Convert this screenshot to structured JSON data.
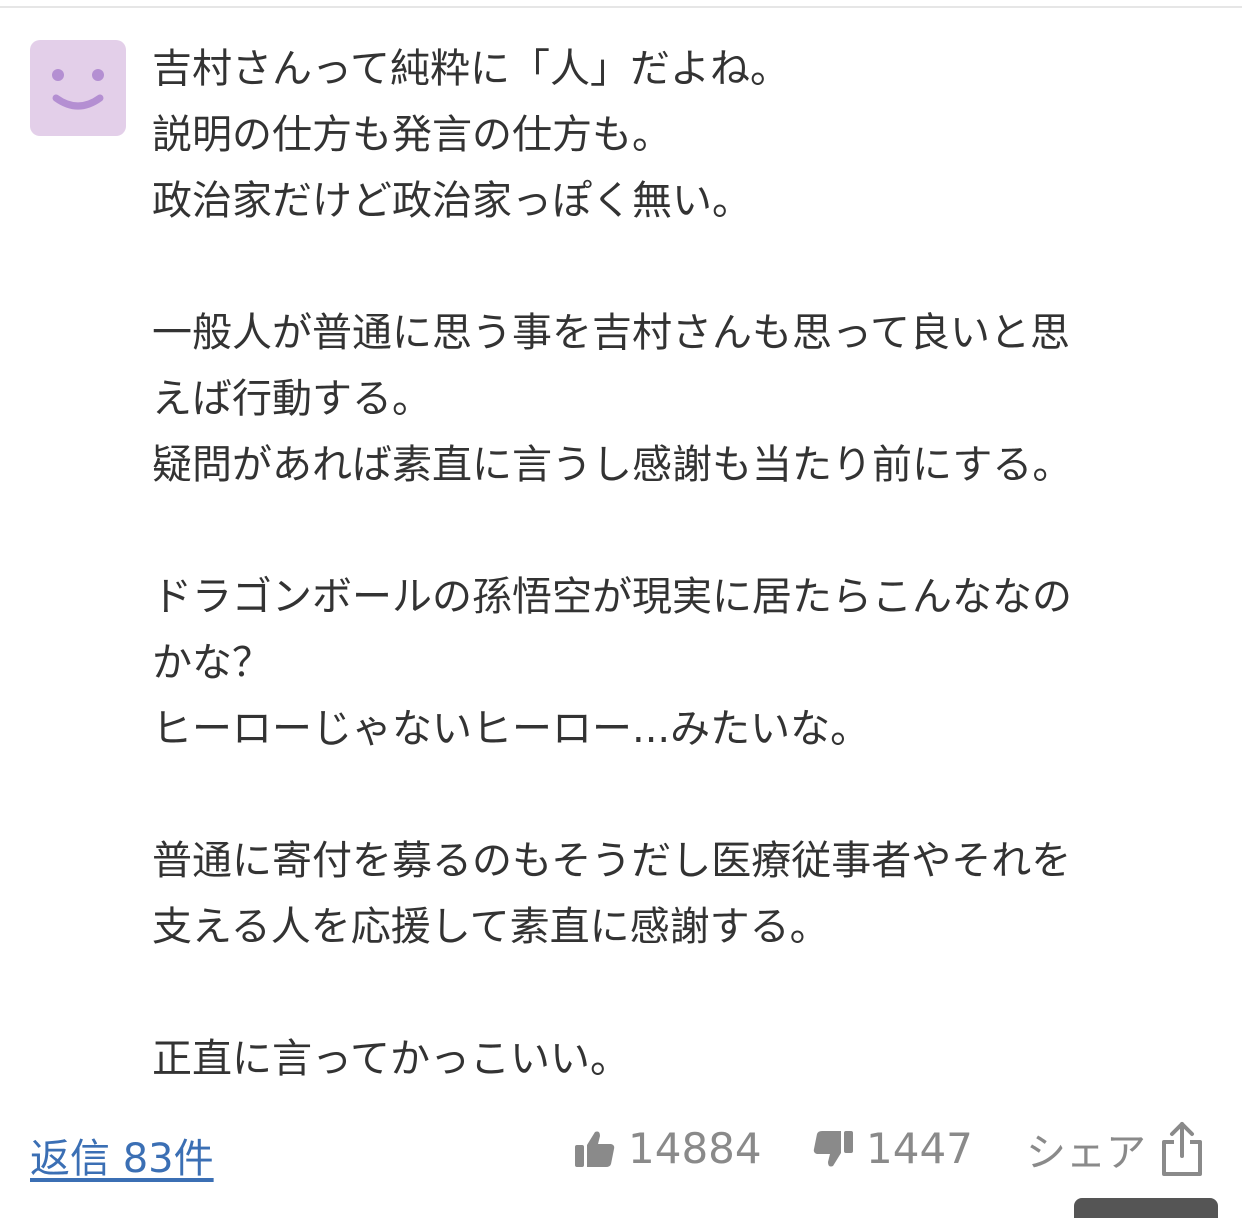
{
  "comment": {
    "lines": [
      "吉村さんって純粋に「人」だよね。",
      "説明の仕方も発言の仕方も。",
      "政治家だけど政治家っぽく無い。",
      "",
      "一般人が普通に思う事を吉村さんも思って良いと思",
      "えば行動する。",
      "疑問があれば素直に言うし感謝も当たり前にする。",
      "",
      "ドラゴンボールの孫悟空が現実に居たらこんななの",
      "かな？",
      "ヒーローじゃないヒーロー...みたいな。",
      "",
      "普通に寄付を募るのもそうだし医療従事者やそれを",
      "支える人を応援して素直に感謝する。",
      "",
      "正直に言ってかっこいい。"
    ]
  },
  "footer": {
    "reply_label": "返信 83件",
    "like_count": "14884",
    "dislike_count": "1447",
    "share_label": "シェア"
  },
  "colors": {
    "avatar_bg": "#e3cfe9",
    "avatar_face": "#b48fd2",
    "link": "#3b6fb4",
    "meta": "#8a8a8a"
  },
  "icons": [
    "smiley-avatar-icon",
    "thumbs-up-icon",
    "thumbs-down-icon",
    "share-icon"
  ]
}
